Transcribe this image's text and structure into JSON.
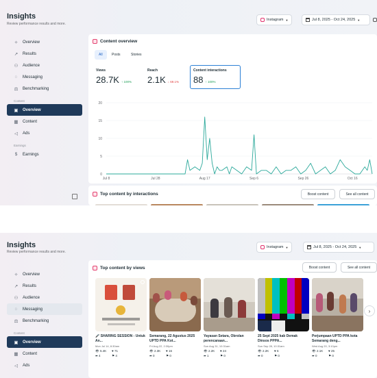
{
  "header": {
    "title": "Insights",
    "subtitle": "Review performance results and more.",
    "platform": "Instagram",
    "date_range": "Jul 8, 2025 - Oct 24, 2025"
  },
  "sidebar": {
    "items": [
      {
        "label": "Overview",
        "icon": "sparkle-icon"
      },
      {
        "label": "Results",
        "icon": "trend-icon"
      },
      {
        "label": "Audience",
        "icon": "people-icon"
      },
      {
        "label": "Messaging",
        "icon": "chat-icon"
      },
      {
        "label": "Benchmarking",
        "icon": "benchmark-icon"
      }
    ],
    "section_content": "Content",
    "content_items": [
      {
        "label": "Overview",
        "icon": "gallery-icon"
      },
      {
        "label": "Content",
        "icon": "grid-icon"
      },
      {
        "label": "Ads",
        "icon": "megaphone-icon"
      }
    ],
    "section_earnings": "Earnings",
    "earnings_items": [
      {
        "label": "Earnings",
        "icon": "dollar-icon"
      }
    ]
  },
  "content_overview": {
    "title": "Content overview",
    "tabs": [
      "All",
      "Posts",
      "Stories"
    ],
    "selected_tab": "All",
    "metrics": [
      {
        "label": "Views",
        "value": "28.7K",
        "change": "↑ 100%",
        "direction": "up"
      },
      {
        "label": "Reach",
        "value": "2.1K",
        "change": "↓ 69.1%",
        "direction": "down"
      },
      {
        "label": "Content interactions",
        "value": "88",
        "change": "↑ 100%",
        "direction": "up"
      }
    ]
  },
  "chart_data": {
    "type": "line",
    "title": "",
    "xlabel": "",
    "ylabel": "",
    "ylim": [
      0,
      20
    ],
    "yticks": [
      0,
      5,
      10,
      15,
      20
    ],
    "xtick_labels": [
      "Jul 8",
      "Jul 28",
      "Aug 17",
      "Sep 6",
      "Sep 26",
      "Oct 16"
    ],
    "grid": true,
    "series": [
      {
        "color": "#2aa89a",
        "x": [
          "Jul 8",
          "Jul 12",
          "Jul 16",
          "Jul 20",
          "Jul 24",
          "Jul 28",
          "Aug 1",
          "Aug 5",
          "Aug 7",
          "Aug 9",
          "Aug 10",
          "Aug 11",
          "Aug 13",
          "Aug 15",
          "Aug 16",
          "Aug 17",
          "Aug 18",
          "Aug 19",
          "Aug 20",
          "Aug 21",
          "Aug 22",
          "Aug 23",
          "Aug 24",
          "Aug 26",
          "Aug 27",
          "Aug 28",
          "Aug 30",
          "Sep 1",
          "Sep 2",
          "Sep 3",
          "Sep 5",
          "Sep 6",
          "Sep 7",
          "Sep 9",
          "Sep 11",
          "Sep 13",
          "Sep 15",
          "Sep 17",
          "Sep 19",
          "Sep 21",
          "Sep 23",
          "Sep 25",
          "Sep 27",
          "Sep 29",
          "Oct 1",
          "Oct 3",
          "Oct 5",
          "Oct 7",
          "Oct 9",
          "Oct 11",
          "Oct 13",
          "Oct 15",
          "Oct 17",
          "Oct 19",
          "Oct 21",
          "Oct 22",
          "Oct 23",
          "Oct 24"
        ],
        "y": [
          0,
          0,
          0,
          0,
          0,
          0,
          0,
          0,
          0,
          0,
          4,
          1,
          2,
          1,
          3,
          16,
          4,
          10,
          3,
          0,
          2,
          1,
          1,
          2,
          0,
          2,
          1,
          0,
          1,
          2,
          1,
          11,
          0,
          1,
          1,
          0,
          2,
          0,
          1,
          1,
          2,
          0,
          1,
          3,
          0,
          1,
          2,
          0,
          1,
          4,
          2,
          1,
          0,
          0,
          2,
          1,
          4,
          0
        ]
      }
    ]
  },
  "top_interactions": {
    "title": "Top content by interactions",
    "boost_label": "Boost content",
    "see_all_label": "See all content"
  },
  "top_views": {
    "title": "Top content by views",
    "boost_label": "Boost content",
    "see_all_label": "See all content",
    "posts": [
      {
        "caption": "🎤 SHARING SESSION - Untuk An...",
        "date": "Mon Jul 14, 8:30am",
        "views": "5.4K",
        "likes": "71",
        "shares": "4",
        "saves": "4"
      },
      {
        "caption": "Semarang, 22 Agustus 2025 UPTD PPA Kot...",
        "date": "Fri Aug 22, 2:30pm",
        "views": "2.3K",
        "likes": "16",
        "shares": "0",
        "saves": "0"
      },
      {
        "caption": "Yayasan Setara, Obrolan perencanaan...",
        "date": "Sun Aug 31, 10:31am",
        "views": "2.2K",
        "likes": "24",
        "shares": "1",
        "saves": "0"
      },
      {
        "caption": "25 Sept 2025 kab Demak Dinsos PPPA...",
        "date": "Sun Sep 28, 10:31am",
        "views": "2.2K",
        "likes": "6",
        "shares": "0",
        "saves": "0"
      },
      {
        "caption": "Perjumpaan UPTD PPA kota Semarang deng...",
        "date": "Wed Aug 20, 3:10pm",
        "views": "2.1K",
        "likes": "25",
        "shares": "0",
        "saves": "0"
      }
    ]
  }
}
